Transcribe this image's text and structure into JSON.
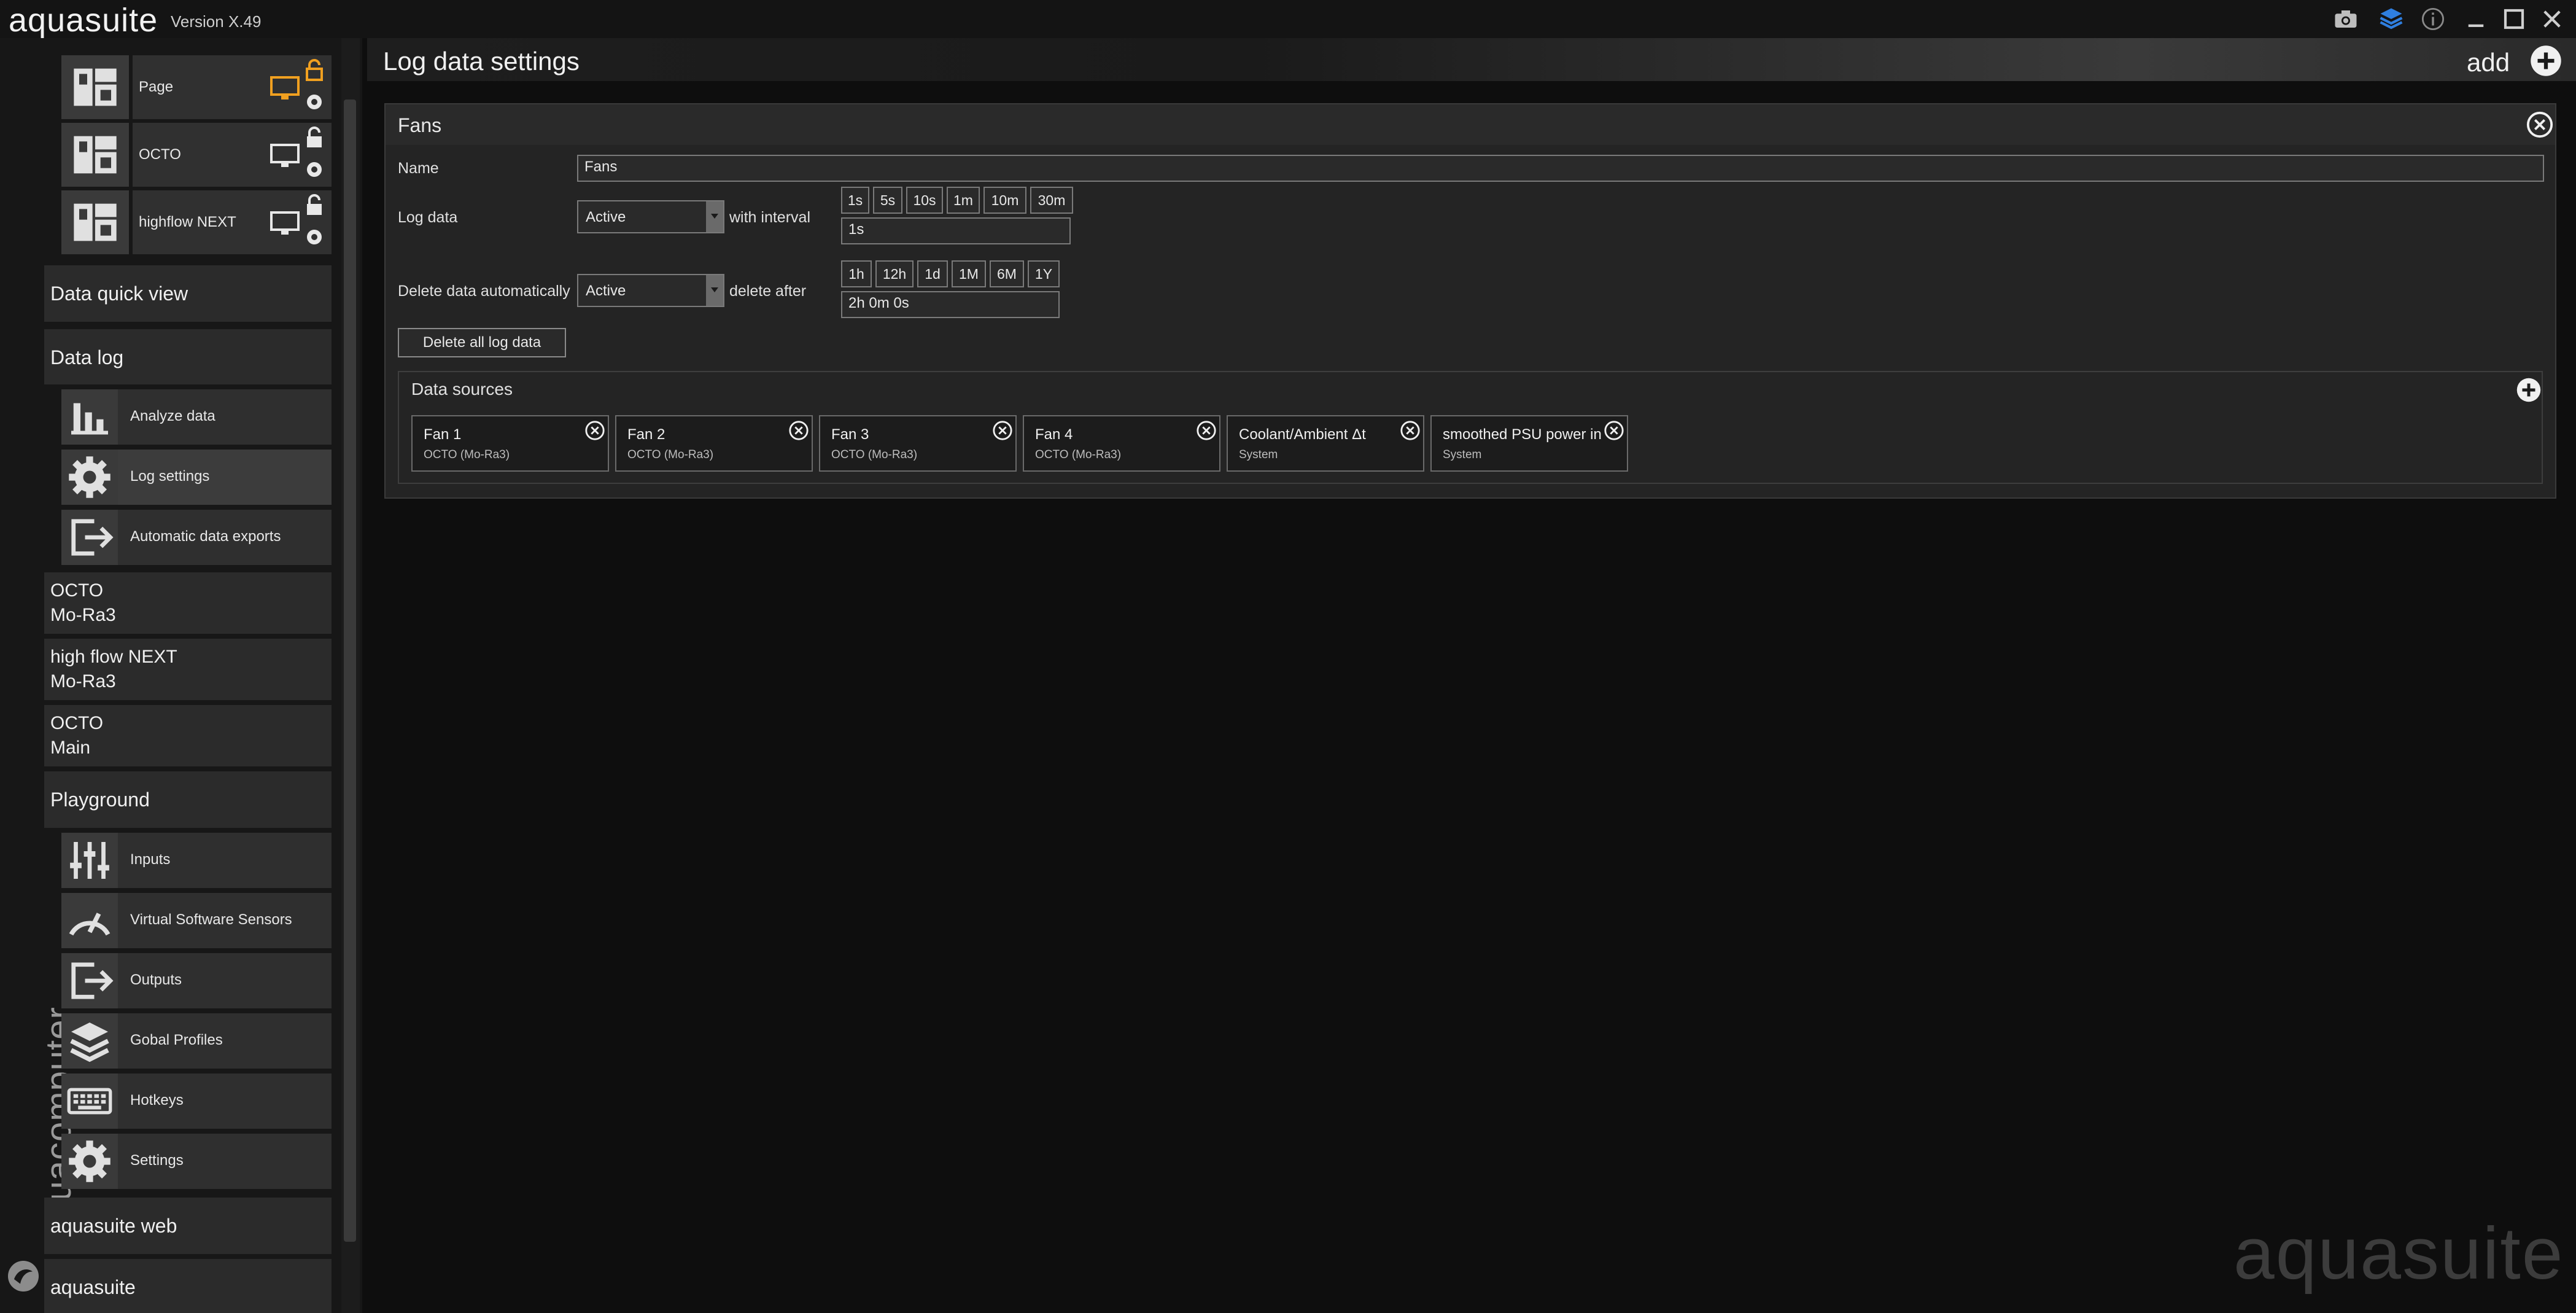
{
  "titlebar": {
    "app_name": "aquasuite",
    "version": "Version X.49",
    "icons": [
      "camera-icon",
      "layers-icon",
      "info-icon",
      "minimize-icon",
      "maximize-icon",
      "close-icon"
    ]
  },
  "sidebar": {
    "dashboards": [
      {
        "label": "Page",
        "highlight": true
      },
      {
        "label": "OCTO",
        "highlight": false
      },
      {
        "label": "highflow NEXT",
        "highlight": false
      }
    ],
    "data_quick_view": "Data quick view",
    "data_log": "Data log",
    "data_log_items": [
      {
        "label": "Analyze data",
        "icon": "bar-chart-icon"
      },
      {
        "label": "Log settings",
        "icon": "gear-icon"
      },
      {
        "label": "Automatic data exports",
        "icon": "export-icon"
      }
    ],
    "devices": [
      {
        "line1": "OCTO",
        "line2": "Mo-Ra3"
      },
      {
        "line1": "high flow NEXT",
        "line2": "Mo-Ra3"
      },
      {
        "line1": "OCTO",
        "line2": "Main"
      }
    ],
    "playground": "Playground",
    "playground_items": [
      {
        "label": "Inputs",
        "icon": "sliders-icon"
      },
      {
        "label": "Virtual Software Sensors",
        "icon": "gauge-icon"
      },
      {
        "label": "Outputs",
        "icon": "export-icon"
      },
      {
        "label": "Gobal Profiles",
        "icon": "layers-icon"
      },
      {
        "label": "Hotkeys",
        "icon": "keyboard-icon"
      },
      {
        "label": "Settings",
        "icon": "gear-icon"
      }
    ],
    "aquasuite_web": "aquasuite web",
    "aquasuite": "aquasuite",
    "brand": "aquacomputer"
  },
  "main": {
    "title": "Log data settings",
    "add_label": "add",
    "panel": {
      "title": "Fans",
      "name_label": "Name",
      "name_value": "Fans",
      "log_data_label": "Log data",
      "log_data_value": "Active",
      "interval_label": "with interval",
      "interval_chips": [
        "1s",
        "5s",
        "10s",
        "1m",
        "10m",
        "30m"
      ],
      "interval_value": "1s",
      "delete_label": "Delete data automatically",
      "delete_value": "Active",
      "delete_after_label": "delete after",
      "delete_chips": [
        "1h",
        "12h",
        "1d",
        "1M",
        "6M",
        "1Y"
      ],
      "delete_after_value": "2h 0m 0s",
      "delete_all_button": "Delete all log data",
      "sources_title": "Data sources",
      "sources": [
        {
          "name": "Fan 1",
          "device": "OCTO (Mo-Ra3)"
        },
        {
          "name": "Fan 2",
          "device": "OCTO (Mo-Ra3)"
        },
        {
          "name": "Fan 3",
          "device": "OCTO (Mo-Ra3)"
        },
        {
          "name": "Fan 4",
          "device": "OCTO (Mo-Ra3)"
        },
        {
          "name": "Coolant/Ambient Δt",
          "device": "System"
        },
        {
          "name": "smoothed PSU power in",
          "device": "System"
        }
      ]
    },
    "watermark": "aquasuite"
  },
  "colors": {
    "accent_orange": "#f0a020",
    "accent_blue": "#2f7fe0",
    "background": "#0e0e0e"
  }
}
